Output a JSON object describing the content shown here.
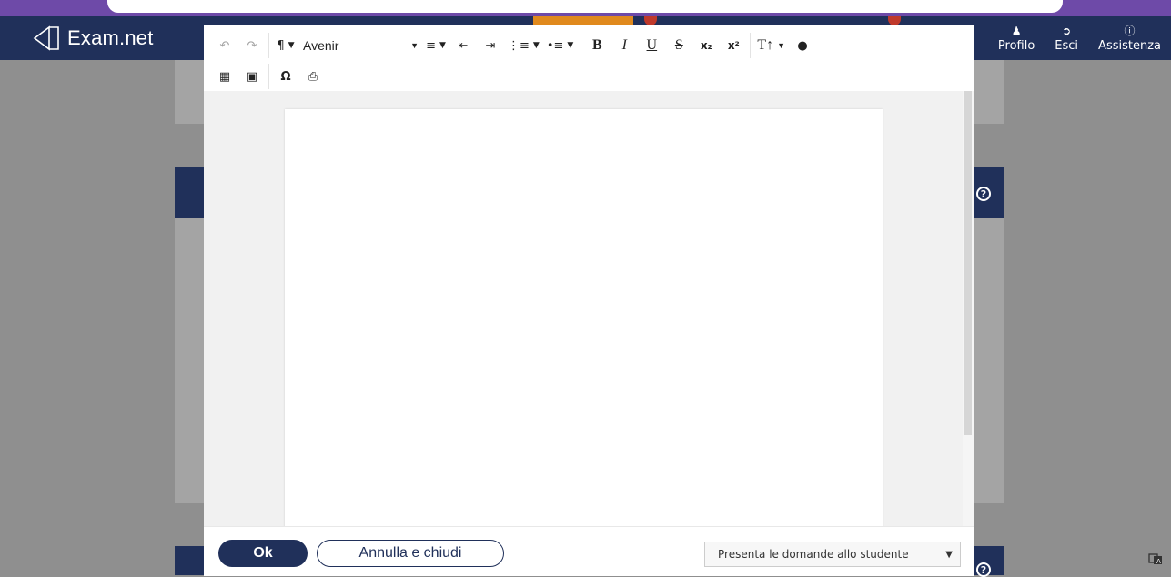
{
  "brand": {
    "name": "Exam.net",
    "icon": "exam-net-logo-icon"
  },
  "nav": {
    "items": [
      {
        "label": "Profilo",
        "icon": "user-icon"
      },
      {
        "label": "Esci",
        "icon": "sign-out-icon"
      },
      {
        "label": "Assistenza",
        "icon": "question-circle-icon"
      }
    ]
  },
  "toolbar": {
    "undo_icon": "undo-icon",
    "redo_icon": "redo-icon",
    "paragraph_icon": "paragraph-icon",
    "font_name": "Avenir"
  },
  "footer": {
    "ok_label": "Ok",
    "cancel_label": "Annulla e chiudi",
    "select_value": "Presenta le domande allo studente"
  },
  "colors": {
    "navbar": "#20305a",
    "accent_top": "#6e4aa8",
    "orange": "#e0891d",
    "overlay": "#8f8f8f"
  }
}
